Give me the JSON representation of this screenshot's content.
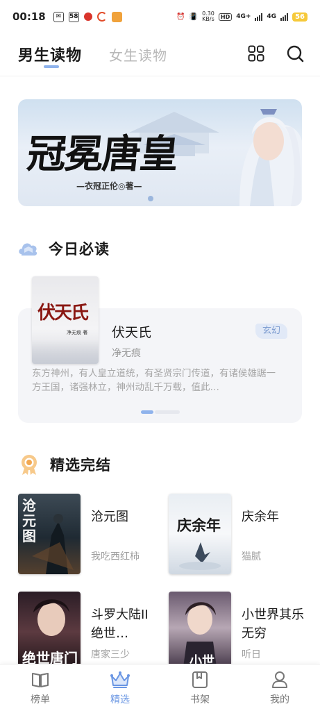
{
  "status_bar": {
    "time": "00:18",
    "icon_names": [
      "mail-icon",
      "app-58-icon",
      "huawei-music-icon",
      "swirl-icon",
      "game-icon"
    ],
    "speed_value": "0.30",
    "speed_unit": "KB/s",
    "hd_label": "HD",
    "sig1_label": "4G+",
    "sig2_label": "4G",
    "battery": "56",
    "battery_color": "#f6c93a"
  },
  "header": {
    "tab_active": "男生读物",
    "tab_inactive": "女生读物",
    "accent_color": "#8fb3ec"
  },
  "banner": {
    "title": "冠冕唐皇",
    "author_line": "—衣冠正伦◎著—"
  },
  "today": {
    "section_title": "今日必读",
    "book": {
      "cover_title": "伏天氏",
      "cover_author": "净无痕 著",
      "name": "伏天氏",
      "author": "净无痕",
      "tag": "玄幻",
      "description": "东方神州，有人皇立道统，有圣贤宗门传道，有诸侯雄踞一方王国，诸强林立，神州动乱千万载，值此…"
    }
  },
  "completed": {
    "section_title": "精选完结",
    "books": [
      {
        "name": "沧元图",
        "author": "我吃西红柿",
        "cover_title": "沧元图"
      },
      {
        "name": "庆余年",
        "author": "猫腻",
        "cover_title": "庆余年"
      },
      {
        "name": "斗罗大陆II绝世…",
        "author": "唐家三少",
        "cover_title": "绝世唐门"
      },
      {
        "name": "小世界其乐无穷",
        "author": "听日",
        "cover_title": "小世"
      }
    ]
  },
  "bottom_nav": [
    {
      "label": "榜单",
      "icon": "book-open-icon",
      "active": false
    },
    {
      "label": "精选",
      "icon": "crown-icon",
      "active": true
    },
    {
      "label": "书架",
      "icon": "bookshelf-icon",
      "active": false
    },
    {
      "label": "我的",
      "icon": "profile-icon",
      "active": false
    }
  ]
}
